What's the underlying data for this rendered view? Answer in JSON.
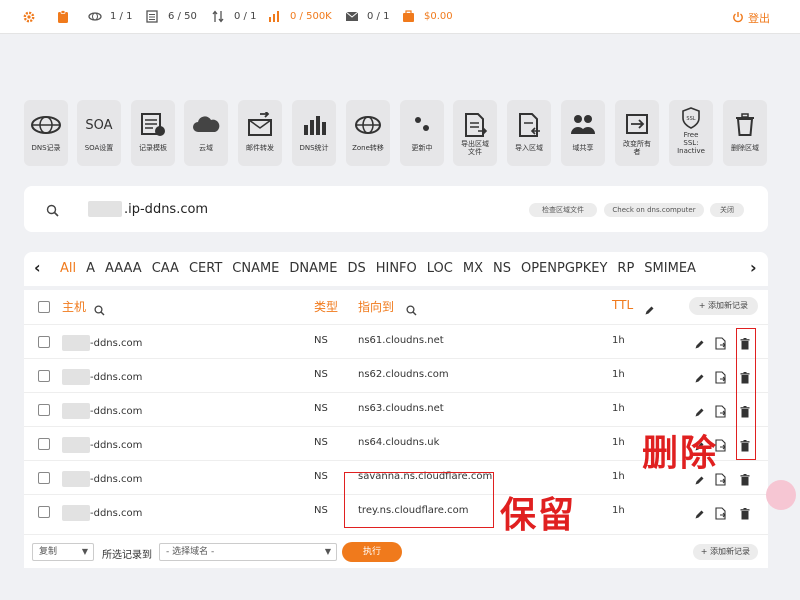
{
  "topbar": {
    "stats": [
      {
        "value": "1 / 1",
        "icon": "zone-icon"
      },
      {
        "value": "6 / 50",
        "icon": "records-icon"
      },
      {
        "value": "0 / 1",
        "icon": "transfer-icon"
      },
      {
        "value": "0 / 500K",
        "icon": "chart-icon"
      },
      {
        "value": "0 / 1",
        "icon": "mail-icon"
      },
      {
        "value": "$0.00",
        "icon": "wallet-icon"
      }
    ],
    "logout": "登出"
  },
  "toolbar": [
    {
      "label": "DNS记录",
      "icon": "globe-icon"
    },
    {
      "label": "SOA设置",
      "icon": "soa-text-icon"
    },
    {
      "label": "记录模板",
      "icon": "template-icon"
    },
    {
      "label": "云域",
      "icon": "cloud-icon"
    },
    {
      "label": "邮件转发",
      "icon": "mail-forward-icon"
    },
    {
      "label": "DNS统计",
      "icon": "bar-chart-icon"
    },
    {
      "label": "Zone转移",
      "icon": "globe-transfer-icon"
    },
    {
      "label": "更新中",
      "icon": "dots-icon"
    },
    {
      "label": "导出区域\n文件",
      "icon": "export-file-icon"
    },
    {
      "label": "导入区域",
      "icon": "import-file-icon"
    },
    {
      "label": "域共享",
      "icon": "users-icon"
    },
    {
      "label": "改变所有\n者",
      "icon": "change-owner-icon"
    },
    {
      "label": "Free\nSSL:\nInactive",
      "icon": "ssl-shield-icon"
    },
    {
      "label": "删除区域",
      "icon": "trash-icon"
    }
  ],
  "search": {
    "domain_suffix": ".ip-ddns.com",
    "buttons": [
      "检查区域文件",
      "Check on dns.computer",
      "关闭"
    ]
  },
  "record_types": [
    "All",
    "A",
    "AAAA",
    "CAA",
    "CERT",
    "CNAME",
    "DNAME",
    "DS",
    "HINFO",
    "LOC",
    "MX",
    "NS",
    "OPENPGPKEY",
    "RP",
    "SMIMEA"
  ],
  "table": {
    "headers": {
      "host": "主机",
      "type": "类型",
      "points_to": "指向到",
      "ttl": "TTL",
      "add": "+ 添加新记录"
    },
    "rows": [
      {
        "host": "-ddns.com",
        "type": "NS",
        "points_to": "ns61.cloudns.net",
        "ttl": "1h"
      },
      {
        "host": "-ddns.com",
        "type": "NS",
        "points_to": "ns62.cloudns.com",
        "ttl": "1h"
      },
      {
        "host": "-ddns.com",
        "type": "NS",
        "points_to": "ns63.cloudns.net",
        "ttl": "1h"
      },
      {
        "host": "-ddns.com",
        "type": "NS",
        "points_to": "ns64.cloudns.uk",
        "ttl": "1h"
      },
      {
        "host": "-ddns.com",
        "type": "NS",
        "points_to": "savanna.ns.cloudflare.com",
        "ttl": "1h"
      },
      {
        "host": "-ddns.com",
        "type": "NS",
        "points_to": "trey.ns.cloudflare.com",
        "ttl": "1h"
      }
    ]
  },
  "annotations": {
    "delete": "删除",
    "keep": "保留"
  },
  "bottom": {
    "copy_select": "复制",
    "selected_to_label": "所选记录到",
    "domain_select": "- 选择域名 -",
    "execute": "执行",
    "add": "+ 添加新记录"
  },
  "colors": {
    "accent": "#f07a1c",
    "annotation": "#e02020"
  }
}
